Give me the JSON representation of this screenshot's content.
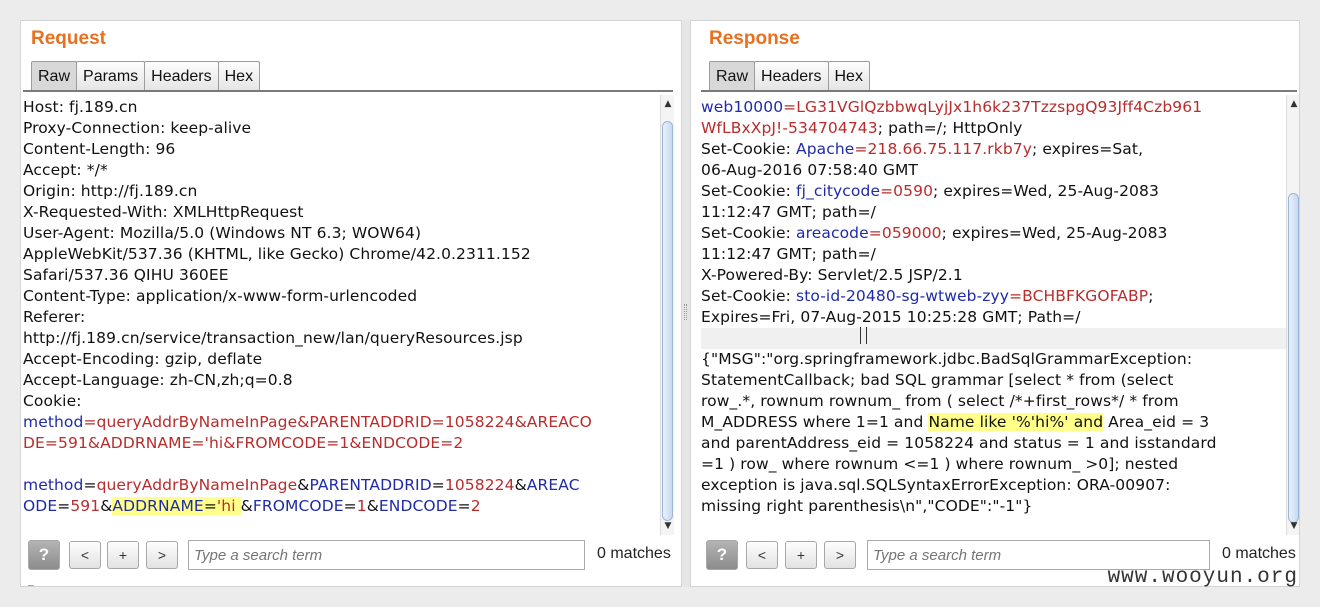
{
  "request": {
    "title": "Request",
    "tabs": [
      "Raw",
      "Params",
      "Headers",
      "Hex"
    ],
    "active_tab": "Raw",
    "lines": [
      [
        {
          "t": "Host: fj.189.cn"
        }
      ],
      [
        {
          "t": "Proxy-Connection: keep-alive"
        }
      ],
      [
        {
          "t": "Content-Length: 96"
        }
      ],
      [
        {
          "t": "Accept: */*"
        }
      ],
      [
        {
          "t": "Origin: http://fj.189.cn"
        }
      ],
      [
        {
          "t": "X-Requested-With: XMLHttpRequest"
        }
      ],
      [
        {
          "t": "User-Agent: Mozilla/5.0 (Windows NT 6.3; WOW64)"
        }
      ],
      [
        {
          "t": "AppleWebKit/537.36 (KHTML, like Gecko) Chrome/42.0.2311.152"
        }
      ],
      [
        {
          "t": "Safari/537.36 QIHU 360EE"
        }
      ],
      [
        {
          "t": "Content-Type: application/x-www-form-urlencoded"
        }
      ],
      [
        {
          "t": "Referer:"
        }
      ],
      [
        {
          "t": "http://fj.189.cn/service/transaction_new/lan/queryResources.jsp"
        }
      ],
      [
        {
          "t": "Accept-Encoding: gzip, deflate"
        }
      ],
      [
        {
          "t": "Accept-Language: zh-CN,zh;q=0.8"
        }
      ],
      [
        {
          "t": "Cookie:"
        }
      ],
      [
        {
          "t": "method",
          "c": "k"
        },
        {
          "t": "=queryAddrByNameInPage&PARENTADDRID=1058224&AREACO",
          "c": "v"
        }
      ],
      [
        {
          "t": "DE=591&ADDRNAME='hi&FROMCODE=1&ENDCODE=2",
          "c": "v"
        }
      ],
      [
        {
          "t": ""
        }
      ],
      [
        {
          "t": "method",
          "c": "k"
        },
        {
          "t": "=",
          "c": ""
        },
        {
          "t": "queryAddrByNameInPage",
          "c": "v"
        },
        {
          "t": "&"
        },
        {
          "t": "PARENTADDRID",
          "c": "k"
        },
        {
          "t": "=",
          "c": ""
        },
        {
          "t": "1058224",
          "c": "v"
        },
        {
          "t": "&"
        },
        {
          "t": "AREAC",
          "c": "k"
        }
      ],
      [
        {
          "t": "ODE",
          "c": "k"
        },
        {
          "t": "=",
          "c": ""
        },
        {
          "t": "591",
          "c": "v"
        },
        {
          "t": "&"
        },
        {
          "t": "ADDRNAME",
          "c": "k mark"
        },
        {
          "t": "=",
          "c": "mark"
        },
        {
          "t": "'hi ",
          "c": "v mark"
        },
        {
          "t": "&"
        },
        {
          "t": "FROMCODE",
          "c": "k"
        },
        {
          "t": "=",
          "c": ""
        },
        {
          "t": "1",
          "c": "v"
        },
        {
          "t": "&"
        },
        {
          "t": "ENDCODE",
          "c": "k"
        },
        {
          "t": "=",
          "c": ""
        },
        {
          "t": "2",
          "c": "v"
        }
      ]
    ],
    "search": {
      "placeholder": "Type a search term",
      "matches": "0 matches"
    },
    "footer_text": "P"
  },
  "response": {
    "title": "Response",
    "tabs": [
      "Raw",
      "Headers",
      "Hex"
    ],
    "active_tab": "Raw",
    "lines": [
      [
        {
          "t": "web10000",
          "c": "k"
        },
        {
          "t": "=LG31VGlQzbbwqLyjJx1h6k237TzzspgQ93Jff4Czb961",
          "c": "v"
        }
      ],
      [
        {
          "t": "WfLBxXpJ!-534704743",
          "c": "v"
        },
        {
          "t": "; path=/; HttpOnly"
        }
      ],
      [
        {
          "t": "Set-Cookie: "
        },
        {
          "t": "Apache",
          "c": "k"
        },
        {
          "t": "=218.66.75.117.rkb7y",
          "c": "v"
        },
        {
          "t": "; expires=Sat,"
        }
      ],
      [
        {
          "t": "06-Aug-2016 07:58:40 GMT"
        }
      ],
      [
        {
          "t": "Set-Cookie: "
        },
        {
          "t": "fj_citycode",
          "c": "k"
        },
        {
          "t": "=0590",
          "c": "v"
        },
        {
          "t": "; expires=Wed, 25-Aug-2083"
        }
      ],
      [
        {
          "t": "11:12:47 GMT; path=/"
        }
      ],
      [
        {
          "t": "Set-Cookie: "
        },
        {
          "t": "areacode",
          "c": "k"
        },
        {
          "t": "=059000",
          "c": "v"
        },
        {
          "t": "; expires=Wed, 25-Aug-2083"
        }
      ],
      [
        {
          "t": "11:12:47 GMT; path=/"
        }
      ],
      [
        {
          "t": "X-Powered-By: Servlet/2.5 JSP/2.1"
        }
      ],
      [
        {
          "t": "Set-Cookie: "
        },
        {
          "t": "sto-id-20480-sg-wtweb-zyy",
          "c": "k"
        },
        {
          "t": "=BCHBFKGOFABP",
          "c": "v"
        },
        {
          "t": ";"
        }
      ],
      [
        {
          "t": "Expires=Fri, 07-Aug-2015 10:25:28 GMT; Path=/"
        }
      ],
      [
        {
          "t": "",
          "hl": true
        }
      ],
      [
        {
          "t": "{\"MSG\":\"org.springframework.jdbc.BadSqlGrammarException:"
        }
      ],
      [
        {
          "t": "StatementCallback; bad SQL grammar [select *  from (select"
        }
      ],
      [
        {
          "t": "row_.*, rownum rownum_  from ( select /*+first_rows*/ * from"
        }
      ],
      [
        {
          "t": "M_ADDRESS where 1=1  and "
        },
        {
          "t": "Name like '%'hi%' and",
          "c": "mark"
        },
        {
          "t": " Area_eid = 3"
        }
      ],
      [
        {
          "t": "and parentAddress_eid = 1058224 and status = 1 and isstandard"
        }
      ],
      [
        {
          "t": "=1   ) row_ where rownum <=1 )  where rownum_ >0]; nested"
        }
      ],
      [
        {
          "t": "exception is java.sql.SQLSyntaxErrorException: ORA-00907:"
        }
      ],
      [
        {
          "t": "missing right parenthesis\\n\",\"CODE\":\"-1\"}"
        }
      ]
    ],
    "search": {
      "placeholder": "Type a search term",
      "matches": "0 matches"
    }
  },
  "search_buttons": {
    "help": "?",
    "prev": "<",
    "add": "+",
    "next": ">"
  },
  "watermark": "www.wooyun.org"
}
